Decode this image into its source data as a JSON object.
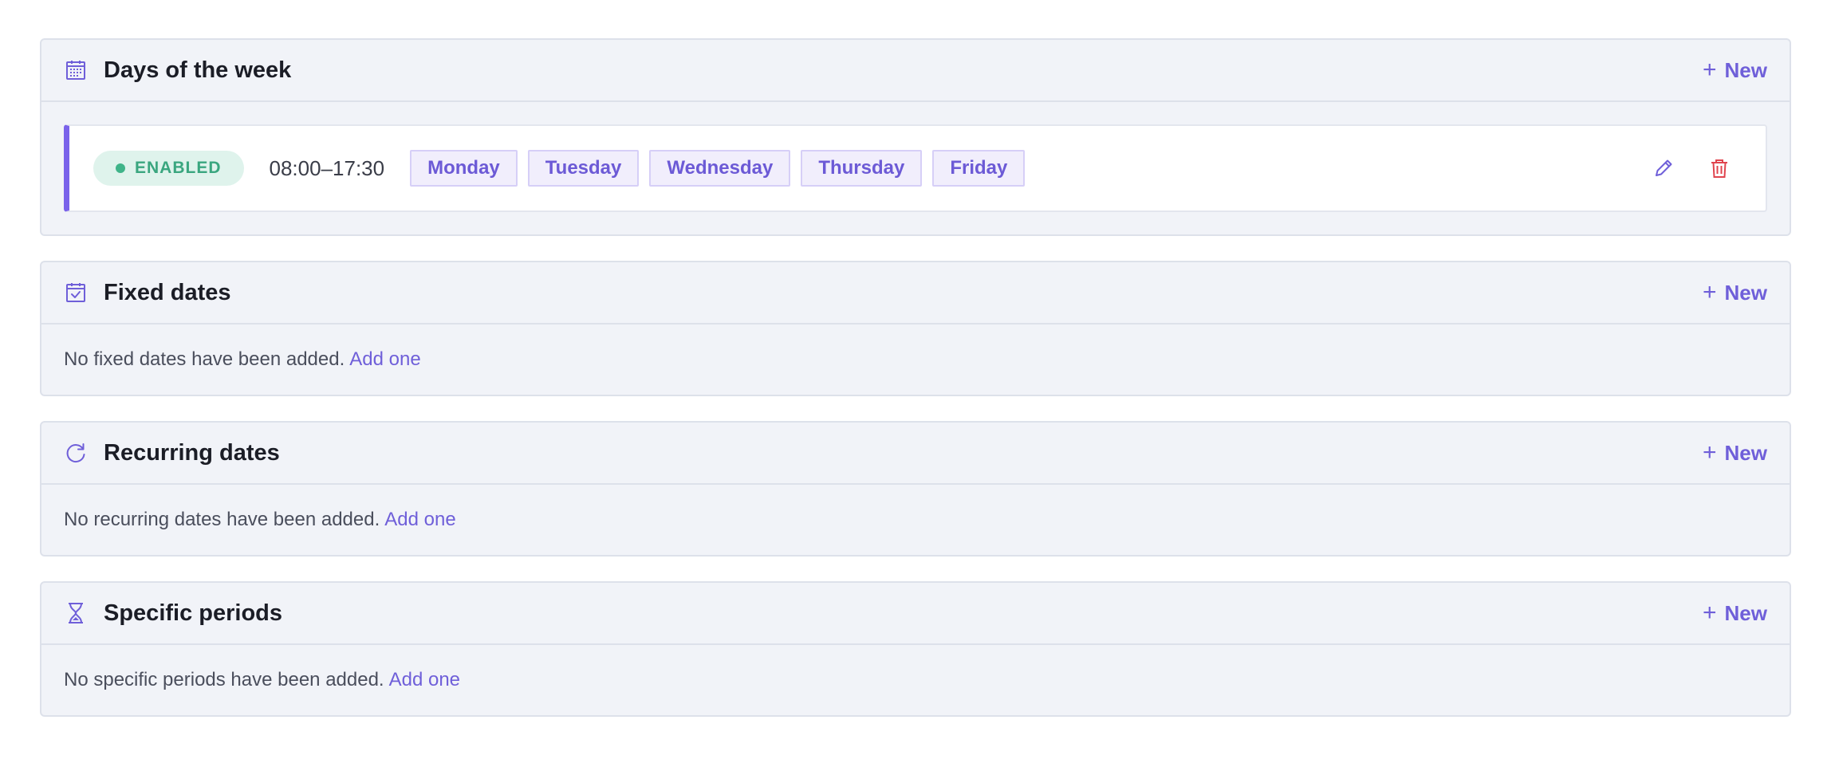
{
  "sections": {
    "days_of_week": {
      "title": "Days of the week",
      "icon": "calendar-grid-icon",
      "new_label": "New",
      "schedule": {
        "status": "ENABLED",
        "status_color": "#3aa67f",
        "time_range": "08:00–17:30",
        "days": [
          "Monday",
          "Tuesday",
          "Wednesday",
          "Thursday",
          "Friday"
        ]
      }
    },
    "fixed_dates": {
      "title": "Fixed dates",
      "icon": "calendar-check-icon",
      "new_label": "New",
      "empty_text": "No fixed dates have been added.",
      "add_link": "Add one"
    },
    "recurring_dates": {
      "title": "Recurring dates",
      "icon": "refresh-icon",
      "new_label": "New",
      "empty_text": "No recurring dates have been added.",
      "add_link": "Add one"
    },
    "specific_periods": {
      "title": "Specific periods",
      "icon": "hourglass-icon",
      "new_label": "New",
      "empty_text": "No specific periods have been added.",
      "add_link": "Add one"
    }
  },
  "colors": {
    "accent": "#6f5fd9",
    "delete": "#e0444e",
    "section_bg": "#f1f3f8"
  }
}
